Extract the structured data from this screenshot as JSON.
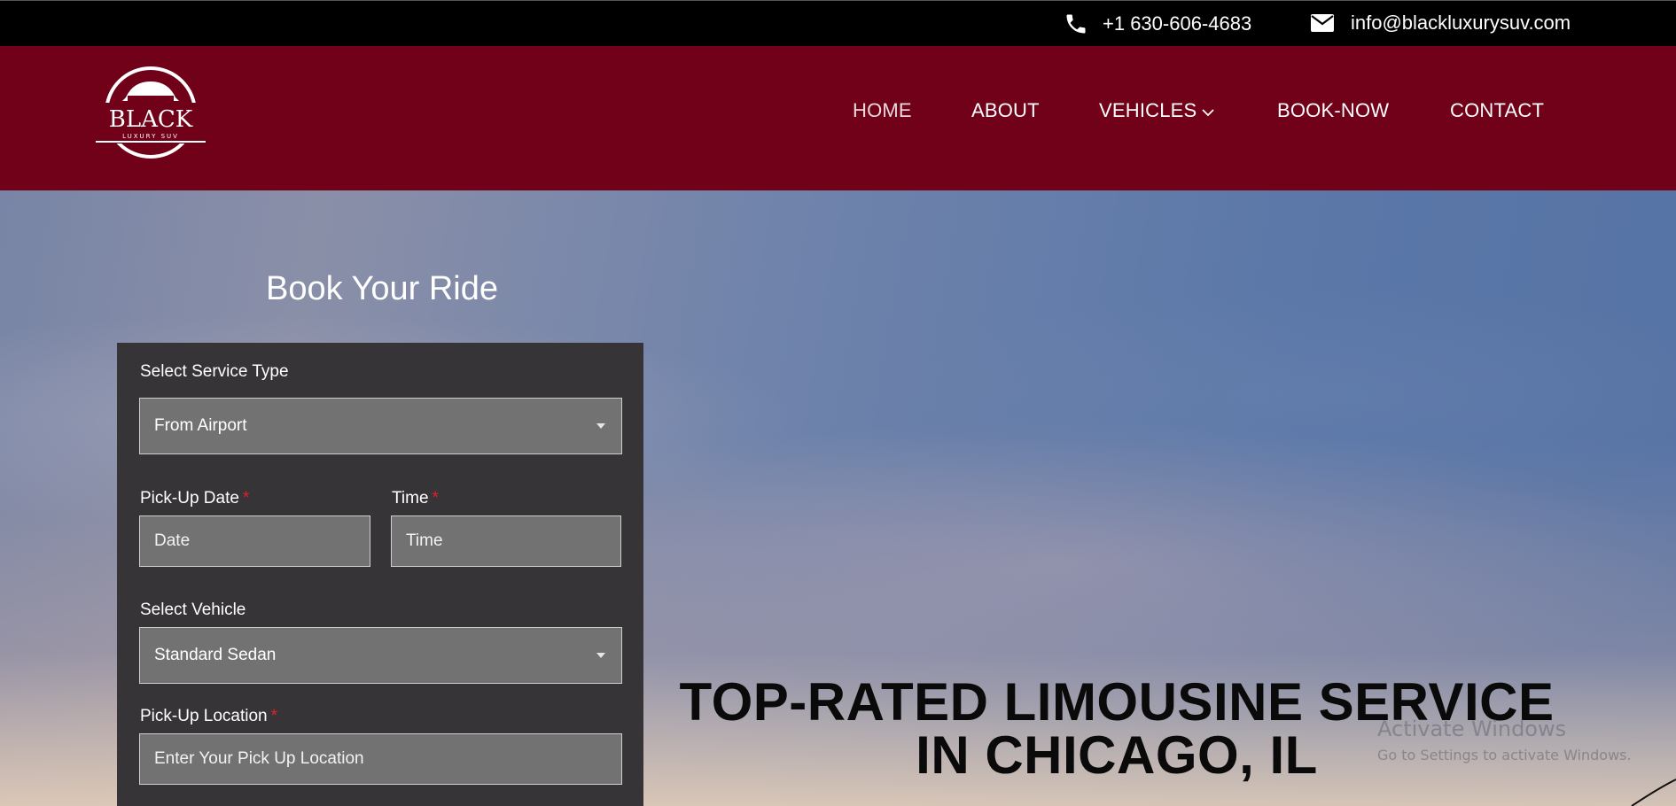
{
  "topbar": {
    "phone": "+1 630-606-4683",
    "email": "info@blackluxurysuv.com",
    "phone_icon": "phone-icon",
    "email_icon": "envelope-icon"
  },
  "logo": {
    "icon": "car-logo-icon",
    "brand": "BLACK",
    "tagline": "LUXURY SUV"
  },
  "nav": {
    "items": [
      {
        "label": "HOME"
      },
      {
        "label": "ABOUT"
      },
      {
        "label": "VEHICLES"
      },
      {
        "label": "BOOK-NOW"
      },
      {
        "label": "CONTACT"
      }
    ],
    "active_color": "#e8d9dc",
    "dropdown_icon": "chevron-down-icon"
  },
  "booking": {
    "title": "Book Your Ride",
    "service_label": "Select Service Type",
    "service_value": "From Airport",
    "date_label": "Pick-Up Date",
    "date_placeholder": "Date",
    "time_label": "Time",
    "time_placeholder": "Time",
    "vehicle_label": "Select Vehicle",
    "vehicle_value": "Standard Sedan",
    "location_label": "Pick-Up Location",
    "location_placeholder": "Enter Your Pick Up Location",
    "required_mark": "*"
  },
  "hero": {
    "heading_line1": "TOP-RATED LIMOUSINE SERVICE",
    "heading_line2": "IN CHICAGO, IL"
  },
  "watermark": {
    "line1": "Activate Windows",
    "line2": "Go to Settings to activate Windows."
  },
  "colors": {
    "brand": "#710019",
    "topbar": "#000000",
    "panel": "#363436",
    "field": "#737273",
    "required": "#e0202a"
  }
}
